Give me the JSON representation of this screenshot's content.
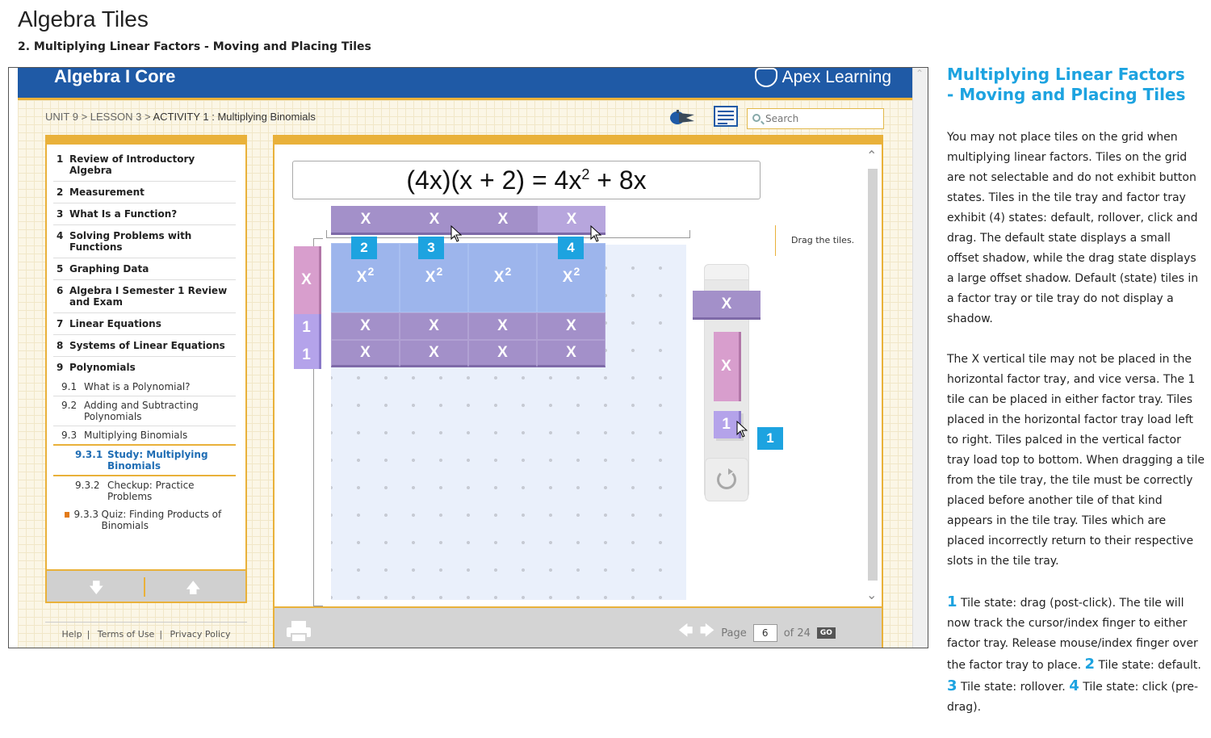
{
  "doc": {
    "title": "Algebra Tiles",
    "subtitle": "2. Multiplying Linear Factors - Moving and Placing Tiles"
  },
  "app": {
    "title": "Algebra I Core",
    "brand": "Apex Learning",
    "breadcrumb": {
      "unit": "UNIT 9",
      "lesson": "LESSON 3",
      "activity": "ACTIVITY 1 : Multiplying Binomials",
      "sep": ">"
    },
    "search": {
      "placeholder": "Search"
    }
  },
  "nav": {
    "items": [
      {
        "num": "1",
        "label": "Review of Introductory Algebra"
      },
      {
        "num": "2",
        "label": "Measurement"
      },
      {
        "num": "3",
        "label": "What Is a Function?"
      },
      {
        "num": "4",
        "label": "Solving Problems with Functions"
      },
      {
        "num": "5",
        "label": "Graphing Data"
      },
      {
        "num": "6",
        "label": "Algebra I Semester 1 Review and Exam"
      },
      {
        "num": "7",
        "label": "Linear Equations"
      },
      {
        "num": "8",
        "label": "Systems of Linear Equations"
      },
      {
        "num": "9",
        "label": "Polynomials"
      }
    ],
    "sub_items": [
      {
        "num": "9.1",
        "label": "What is a Polynomial?"
      },
      {
        "num": "9.2",
        "label": "Adding and Subtracting Polynomials"
      },
      {
        "num": "9.3",
        "label": "Multiplying Binomials"
      }
    ],
    "subsub_items": [
      {
        "num": "9.3.1",
        "label": "Study: Multiplying Binomials"
      },
      {
        "num": "9.3.2",
        "label": "Checkup: Practice Problems"
      },
      {
        "num": "9.3.3",
        "label": "Quiz: Finding Products of Binomials"
      }
    ]
  },
  "legal": {
    "help": "Help",
    "terms": "Terms of Use",
    "privacy": "Privacy Policy",
    "sep": "|"
  },
  "activity": {
    "equation": {
      "lhs": "(4x)(x + 2) = 4x",
      "exp": "2",
      "rhs": " + 8x"
    },
    "instruction": "Drag the tiles.",
    "tile_x": "X",
    "tile_one": "1",
    "tile_x2_base": "X",
    "tile_x2_exp": "2",
    "callouts": {
      "c1": "1",
      "c2": "2",
      "c3": "3",
      "c4": "4"
    }
  },
  "footer": {
    "page_label": "Page",
    "page_value": "6",
    "of_label": "of 24",
    "go": "GO"
  },
  "side": {
    "title": "Multiplying Linear Factors - Moving and Placing Tiles",
    "para1": "You may not place tiles on the grid when multiplying linear factors. Tiles on the grid are not selectable and do not exhibit button states. Tiles in the tile tray and factor tray exhibit (4) states: default, rollover, click and drag. The default state displays a small offset shadow, while the drag state displays a large offset shadow. Default (state) tiles in a factor tray or tile tray do not display a shadow.",
    "para2": "The X vertical tile may not be placed in the horizontal factor tray, and vice versa. The 1 tile can be placed in either factor tray. Tiles placed in the horizontal factor tray load left to right. Tiles palced in the vertical factor tray load top to bottom. When dragging a tile from the tile tray, the tile must be correctly placed before another tile of that kind appears in the tile tray. Tiles which are placed incorrectly return to their respective slots in the tile tray.",
    "p3": {
      "n1": "1",
      "t1": " Tile state: drag (post-click). The tile will now track the cursor/index finger to either factor tray. Release mouse/index finger over the factor tray to place. ",
      "n2": "2",
      "t2": " Tile state: default. ",
      "n3": "3",
      "t3": " Tile state: rollover. ",
      "n4": "4",
      "t4": " Tile state: click (pre-drag)."
    }
  },
  "colors": {
    "accent_blue": "#1da3e0",
    "header_blue": "#1f5aa6",
    "gold": "#e9b13a",
    "tile_purple": "#a390c9",
    "tile_pink": "#d89ecd",
    "tile_blue": "#9db5ec"
  }
}
